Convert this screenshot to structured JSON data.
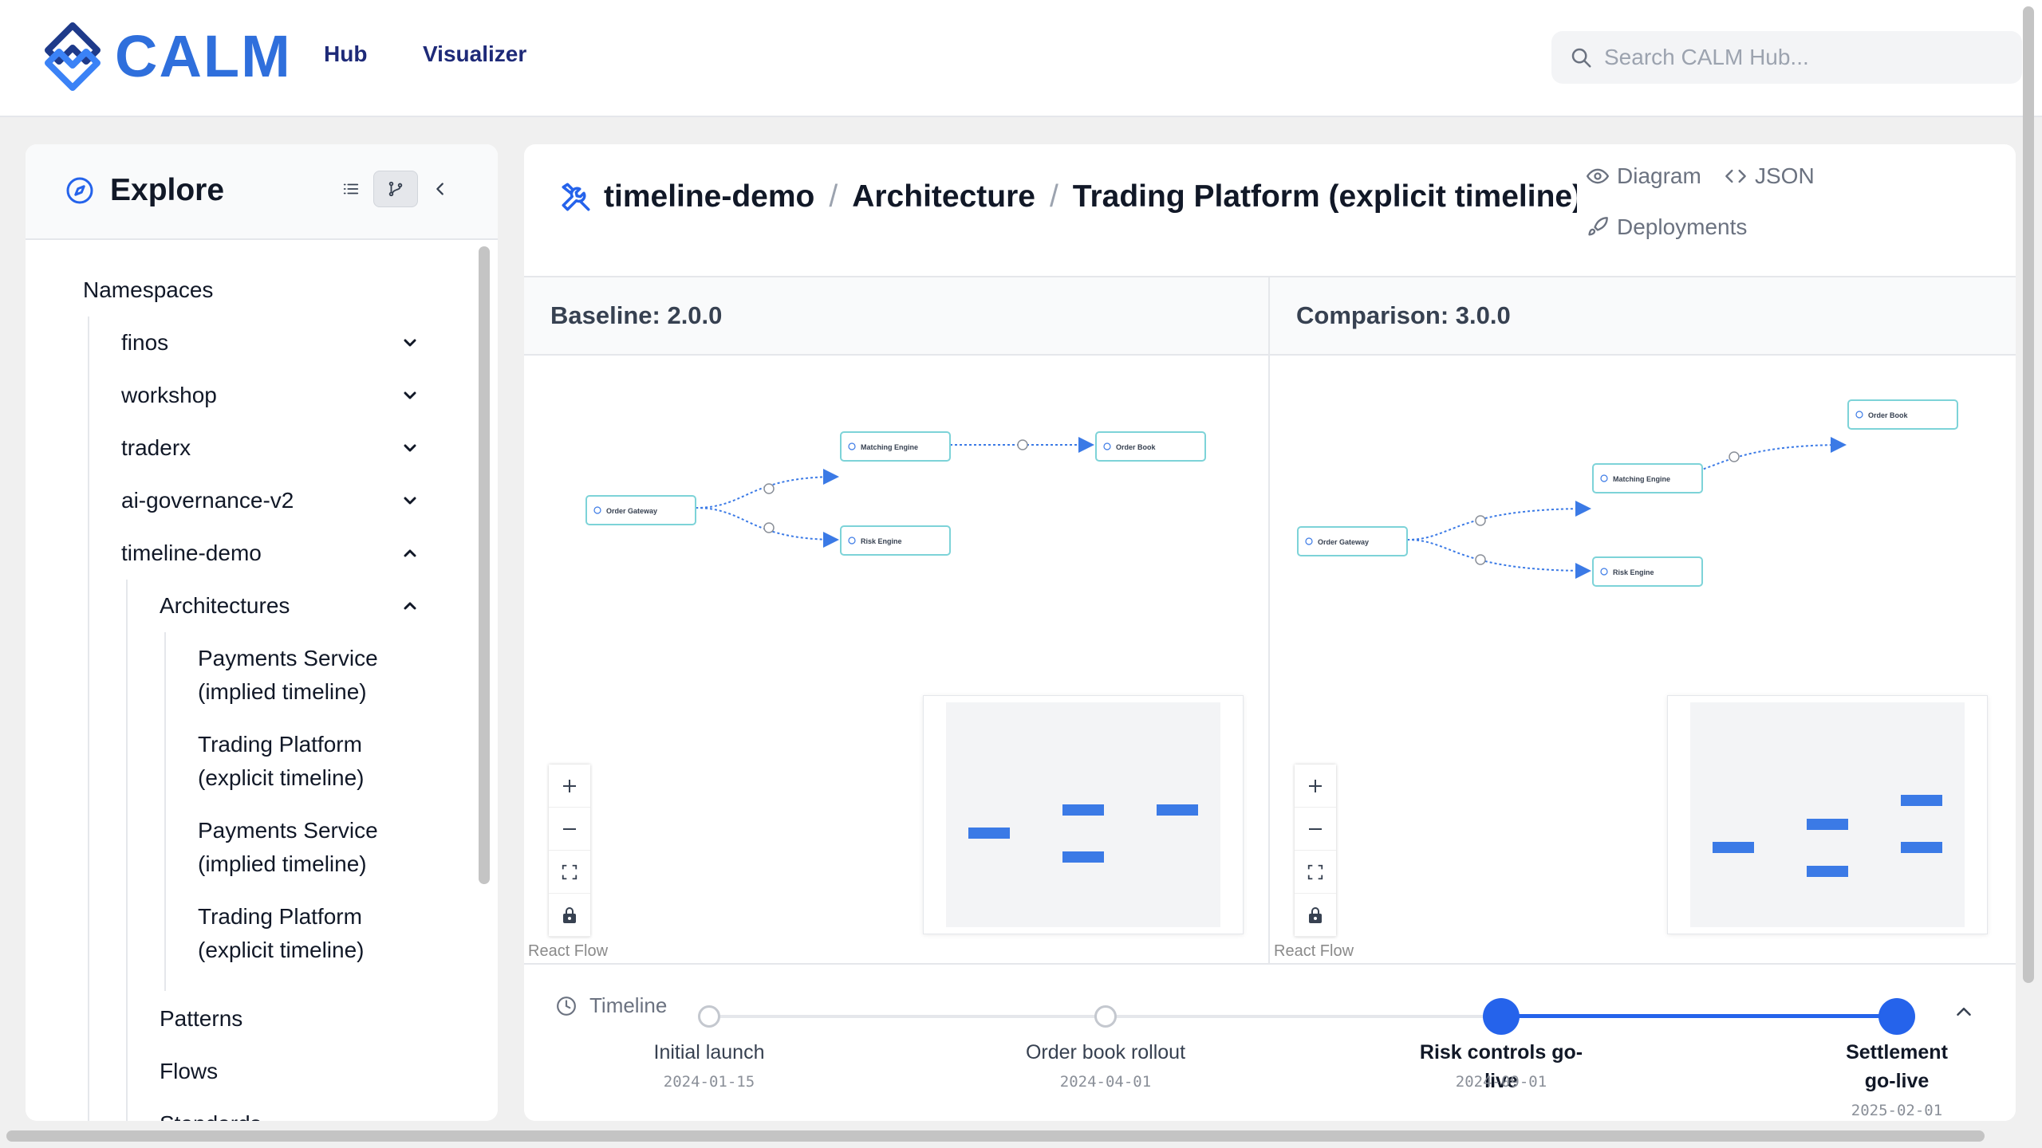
{
  "app": {
    "logo_text": "CALM",
    "brand_color": "#2f6fdc",
    "nav": [
      {
        "label": "Hub"
      },
      {
        "label": "Visualizer"
      }
    ],
    "search_placeholder": "Search CALM Hub..."
  },
  "sidebar": {
    "title": "Explore",
    "tree": {
      "namespaces_label": "Namespaces",
      "namespaces": [
        "finos",
        "workshop",
        "traderx",
        "ai-governance-v2",
        "timeline-demo"
      ],
      "architectures_label": "Architectures",
      "architectures": [
        {
          "line1": "Payments Service",
          "line2": "(implied timeline)"
        },
        {
          "line1": "Trading Platform",
          "line2": "(explicit timeline)"
        },
        {
          "line1": "Payments Service",
          "line2": "(implied timeline)"
        },
        {
          "line1": "Trading Platform",
          "line2": "(explicit timeline)"
        }
      ],
      "patterns_label": "Patterns",
      "flows_label": "Flows",
      "standards_label": "Standards"
    }
  },
  "main": {
    "breadcrumb": [
      "timeline-demo",
      "Architecture",
      "Trading Platform (explicit timeline)"
    ],
    "breadcrumb_sep": "/",
    "tabs": {
      "diagram": "Diagram",
      "json": "JSON",
      "deployments": "Deployments"
    },
    "baseline_label": "Baseline: 2.0.0",
    "comparison_label": "Comparison: 3.0.0",
    "rf_attribution": "React Flow",
    "nodes": {
      "order_gateway": "Order Gateway",
      "matching_engine": "Matching Engine",
      "order_book": "Order Book",
      "risk_engine": "Risk Engine"
    }
  },
  "timeline": {
    "label": "Timeline",
    "moments": [
      {
        "name": "Initial launch",
        "date": "2024-01-15",
        "active": false
      },
      {
        "name": "Order book rollout",
        "date": "2024-04-01",
        "active": false
      },
      {
        "name": "Risk controls go-live",
        "date": "2024-09-01",
        "active": true
      },
      {
        "name_line1": "Settlement",
        "name_line2": "go-live",
        "date": "2025-02-01",
        "active": true
      }
    ]
  }
}
